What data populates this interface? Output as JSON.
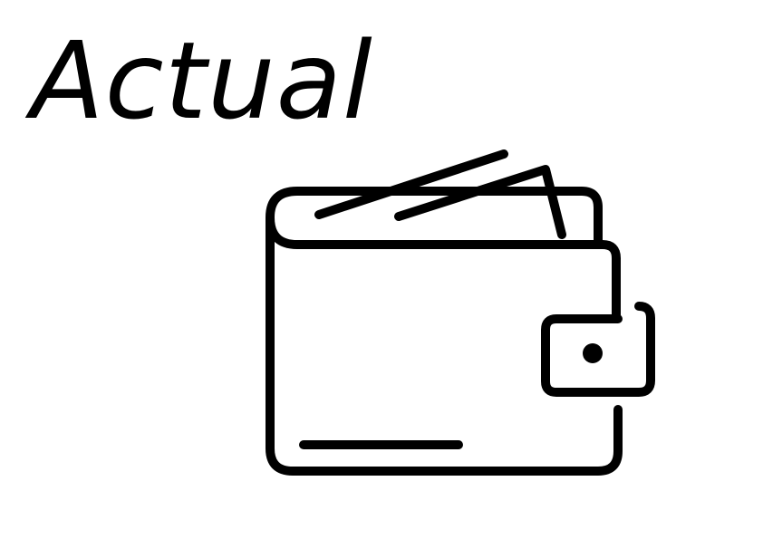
{
  "title": "Actual",
  "icon": {
    "name": "wallet-icon",
    "color": "#000000"
  },
  "colors": {
    "background": "#ffffff",
    "foreground": "#000000"
  }
}
